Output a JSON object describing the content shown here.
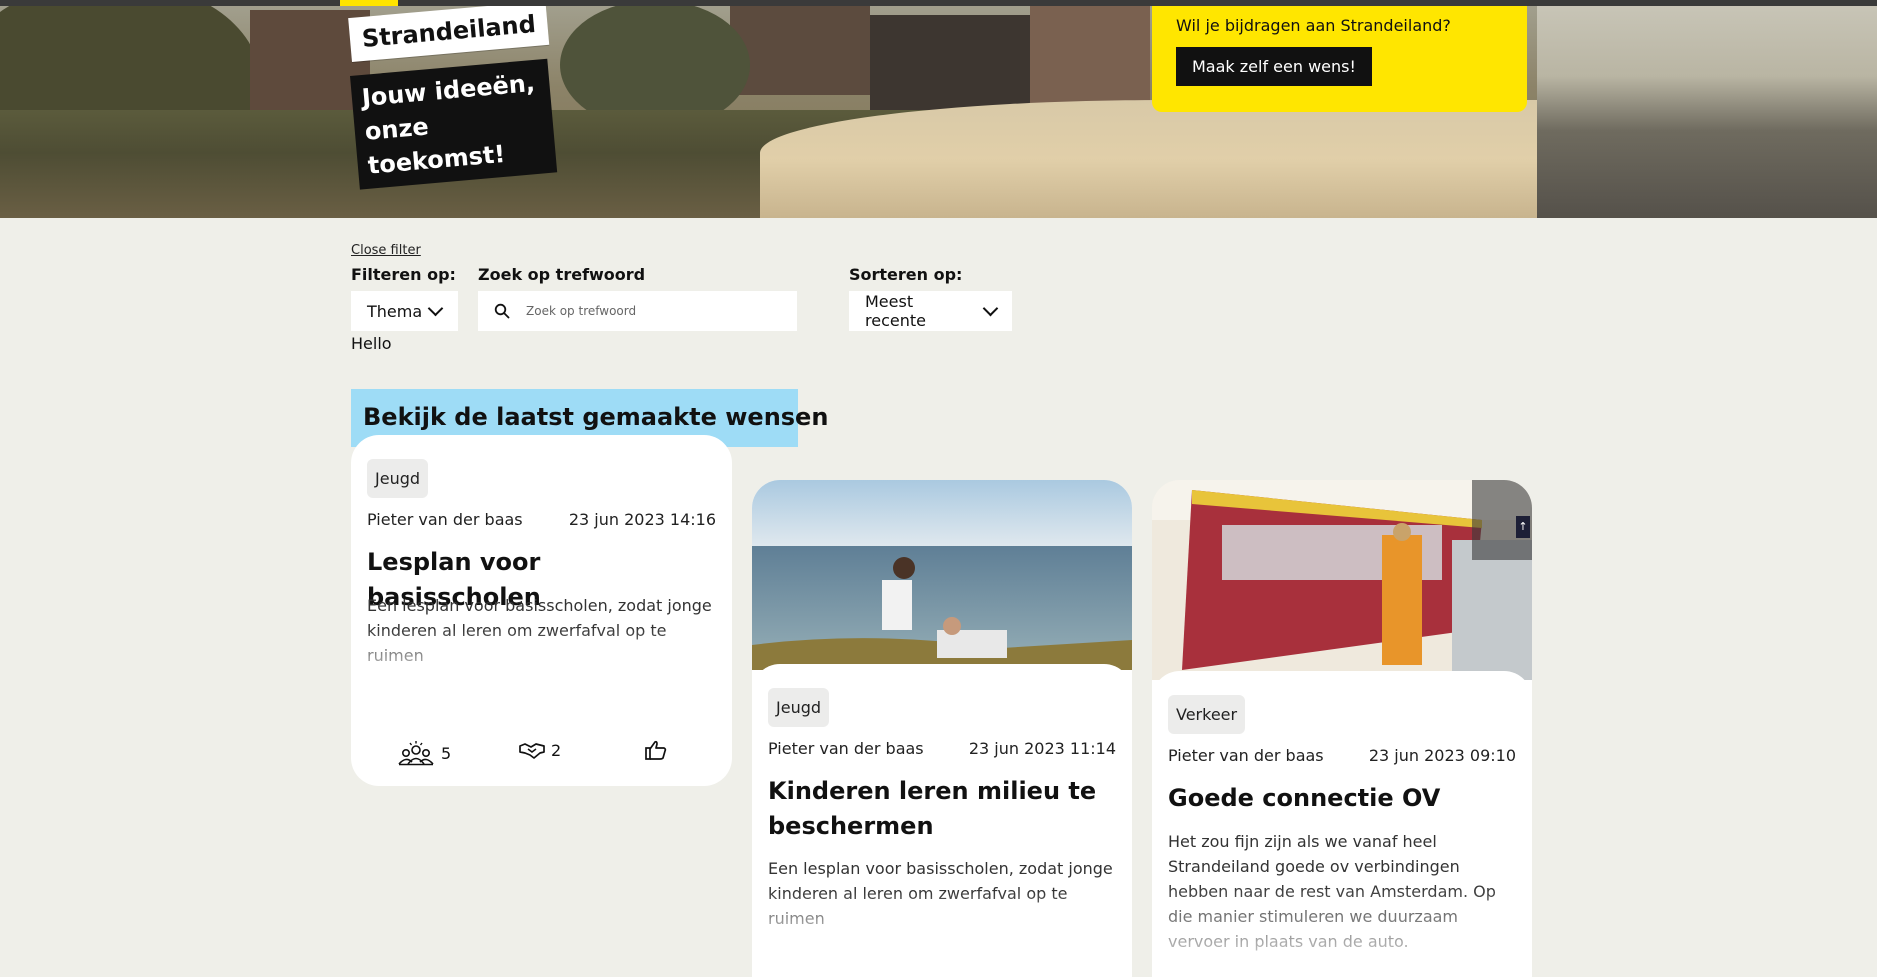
{
  "brand": {
    "name": "Strandeiland",
    "slogan": "Jouw ideeën, onze toekomst!"
  },
  "cta": {
    "question": "Wil je bijdragen aan Strandeiland?",
    "button_label": "Maak zelf een wens!",
    "color": "#ffe600"
  },
  "filters": {
    "close_label": "Close filter",
    "filter_label": "Filteren op:",
    "theme_select": "Thema",
    "search_label": "Zoek op trefwoord",
    "search_placeholder": "Zoek op trefwoord",
    "sort_label": "Sorteren op:",
    "sort_select": "Meest recente",
    "hello": "Hello"
  },
  "section": {
    "title": "Bekijk de laatst gemaakte wensen",
    "color": "#9edcf6"
  },
  "cards": [
    {
      "tag": "Jeugd",
      "author": "Pieter van der baas",
      "date": "23 jun 2023 14:16",
      "title": "Lesplan voor basisscholen",
      "description": "Een lesplan voor basisscholen, zodat jonge kinderen al leren om zwerfafval op te ruimen",
      "supporters": "5",
      "collaborators": "2"
    },
    {
      "tag": "Jeugd",
      "author": "Pieter van der baas",
      "date": "23 jun 2023 11:14",
      "title": "Kinderen leren milieu te beschermen",
      "description": "Een lesplan voor basisscholen, zodat jonge kinderen al leren om zwerfafval op te ruimen"
    },
    {
      "tag": "Verkeer",
      "author": "Pieter van der baas",
      "date": "23 jun 2023 09:10",
      "title": "Goede connectie OV",
      "description": "Het zou fijn zijn als we vanaf heel Strandeiland goede ov verbindingen hebben naar de rest van Amsterdam. Op die manier stimuleren we duurzaam vervoer in plaats van de auto."
    }
  ]
}
